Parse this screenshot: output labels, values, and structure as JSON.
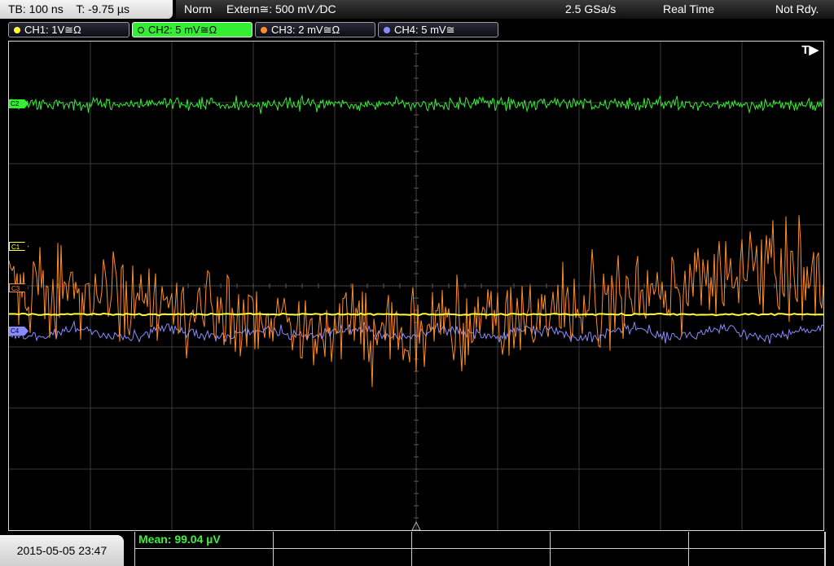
{
  "header": {
    "timebase": "TB: 100 ns",
    "trigger_time": "T: -9.75 µs",
    "mode": "Norm",
    "trigger_source": "Extern≅: 500 mV ∕DC",
    "sample_rate": "2.5 GSa/s",
    "acquisition": "Real Time",
    "status": "Not Rdy."
  },
  "channels": [
    {
      "label": "CH1: 1V≅Ω",
      "color": "#ffff33",
      "marker": "C1"
    },
    {
      "label": "CH2: 5 mV≅Ω",
      "color": "#33ee33",
      "marker": "C2"
    },
    {
      "label": "CH3: 2 mV≅Ω",
      "color": "#ff8c2a",
      "marker": "C3"
    },
    {
      "label": "CH4: 5 mV≅",
      "color": "#8a8aff",
      "marker": "C4"
    }
  ],
  "trigger_marker": "T▶",
  "measurement": {
    "label": "Mean: 99.04 µV"
  },
  "datetime": "2015-05-05 23:47"
}
